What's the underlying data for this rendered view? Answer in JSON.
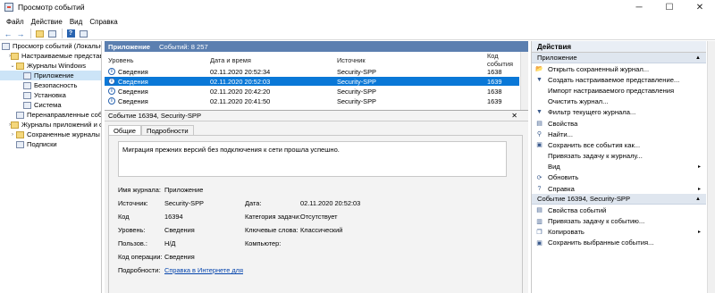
{
  "window": {
    "title": "Просмотр событий"
  },
  "menu": [
    "Файл",
    "Действие",
    "Вид",
    "Справка"
  ],
  "tree": [
    {
      "label": "Просмотр событий (Локальны",
      "indent": 0,
      "chev": "",
      "icon": "viewer-icon"
    },
    {
      "label": "Настраиваемые представле",
      "indent": 1,
      "chev": "›",
      "icon": "folder-icon"
    },
    {
      "label": "Журналы Windows",
      "indent": 1,
      "chev": "⌄",
      "icon": "folder-icon"
    },
    {
      "label": "Приложение",
      "indent": 2,
      "chev": "",
      "icon": "log-icon",
      "selected": true
    },
    {
      "label": "Безопасность",
      "indent": 2,
      "chev": "",
      "icon": "log-icon"
    },
    {
      "label": "Установка",
      "indent": 2,
      "chev": "",
      "icon": "log-icon"
    },
    {
      "label": "Система",
      "indent": 2,
      "chev": "",
      "icon": "log-icon"
    },
    {
      "label": "Перенаправленные собо",
      "indent": 2,
      "chev": "",
      "icon": "log-icon"
    },
    {
      "label": "Журналы приложений и служ",
      "indent": 1,
      "chev": "›",
      "icon": "folder-icon"
    },
    {
      "label": "Сохраненные журналы",
      "indent": 1,
      "chev": "›",
      "icon": "folder-icon"
    },
    {
      "label": "Подписки",
      "indent": 1,
      "chev": "",
      "icon": "subscription-icon"
    }
  ],
  "events_panel": {
    "title": "Приложение",
    "count": "Событий: 8 257",
    "columns": [
      "Уровень",
      "Дата и время",
      "Источник",
      "Код события"
    ],
    "rows": [
      {
        "level": "Сведения",
        "datetime": "02.11.2020 20:52:34",
        "source": "Security-SPP",
        "code": "1638"
      },
      {
        "level": "Сведения",
        "datetime": "02.11.2020 20:52:03",
        "source": "Security-SPP",
        "code": "1639",
        "selected": true
      },
      {
        "level": "Сведения",
        "datetime": "02.11.2020 20:42:20",
        "source": "Security-SPP",
        "code": "1638"
      },
      {
        "level": "Сведения",
        "datetime": "02.11.2020 20:41:50",
        "source": "Security-SPP",
        "code": "1639"
      }
    ]
  },
  "detail": {
    "title": "Событие 16394, Security-SPP",
    "tabs": [
      "Общие",
      "Подробности"
    ],
    "message": "Миграция прежних версий без подключения к сети прошла успешно.",
    "labels": {
      "log_name": "Имя журнала:",
      "source": "Источник:",
      "code": "Код",
      "level": "Уровень:",
      "user": "Пользов.:",
      "opcode": "Код операции:",
      "more_info": "Подробности:",
      "logged": "Дата:",
      "task": "Категория задачи:",
      "keywords": "Ключевые слова:",
      "computer": "Компьютер:"
    },
    "values": {
      "log_name": "Приложение",
      "source": "Security-SPP",
      "code": "16394",
      "level": "Сведения",
      "user": "Н/Д",
      "opcode": "Сведения",
      "more_info": "Справка в Интернете для",
      "logged": "02.11.2020 20:52:03",
      "task": "Отсутствует",
      "keywords": "Классический",
      "computer": ""
    }
  },
  "actions": {
    "title": "Действия",
    "sections": [
      {
        "name": "Приложение",
        "items": [
          {
            "label": "Открыть сохраненный журнал...",
            "icon": "open-folder-icon"
          },
          {
            "label": "Создать настраиваемое представление...",
            "icon": "filter-icon"
          },
          {
            "label": "Импорт настраиваемого представления",
            "icon": "",
            "arrow": ""
          },
          {
            "label": "Очистить журнал...",
            "icon": ""
          },
          {
            "label": "Фильтр текущего журнала...",
            "icon": "filter-icon"
          },
          {
            "label": "Свойства",
            "icon": "properties-icon"
          },
          {
            "label": "Найти...",
            "icon": "find-icon"
          },
          {
            "label": "Сохранить все события как...",
            "icon": "save-icon"
          },
          {
            "label": "Привязать задачу к журналу...",
            "icon": ""
          },
          {
            "label": "Вид",
            "icon": "",
            "arrow": "▸"
          },
          {
            "label": "Обновить",
            "icon": "refresh-icon"
          },
          {
            "label": "Справка",
            "icon": "help-icon",
            "arrow": "▸"
          }
        ]
      },
      {
        "name": "Событие 16394, Security-SPP",
        "items": [
          {
            "label": "Свойства событий",
            "icon": "properties-icon"
          },
          {
            "label": "Привязать задачу к событию...",
            "icon": "task-icon"
          },
          {
            "label": "Копировать",
            "icon": "copy-icon",
            "arrow": "▸"
          },
          {
            "label": "Сохранить выбранные события...",
            "icon": "save-icon"
          }
        ]
      }
    ]
  },
  "colors": {
    "header_blue": "#5b7fb0",
    "selection": "#0a78d7",
    "tree_selection": "#cce4f7"
  }
}
